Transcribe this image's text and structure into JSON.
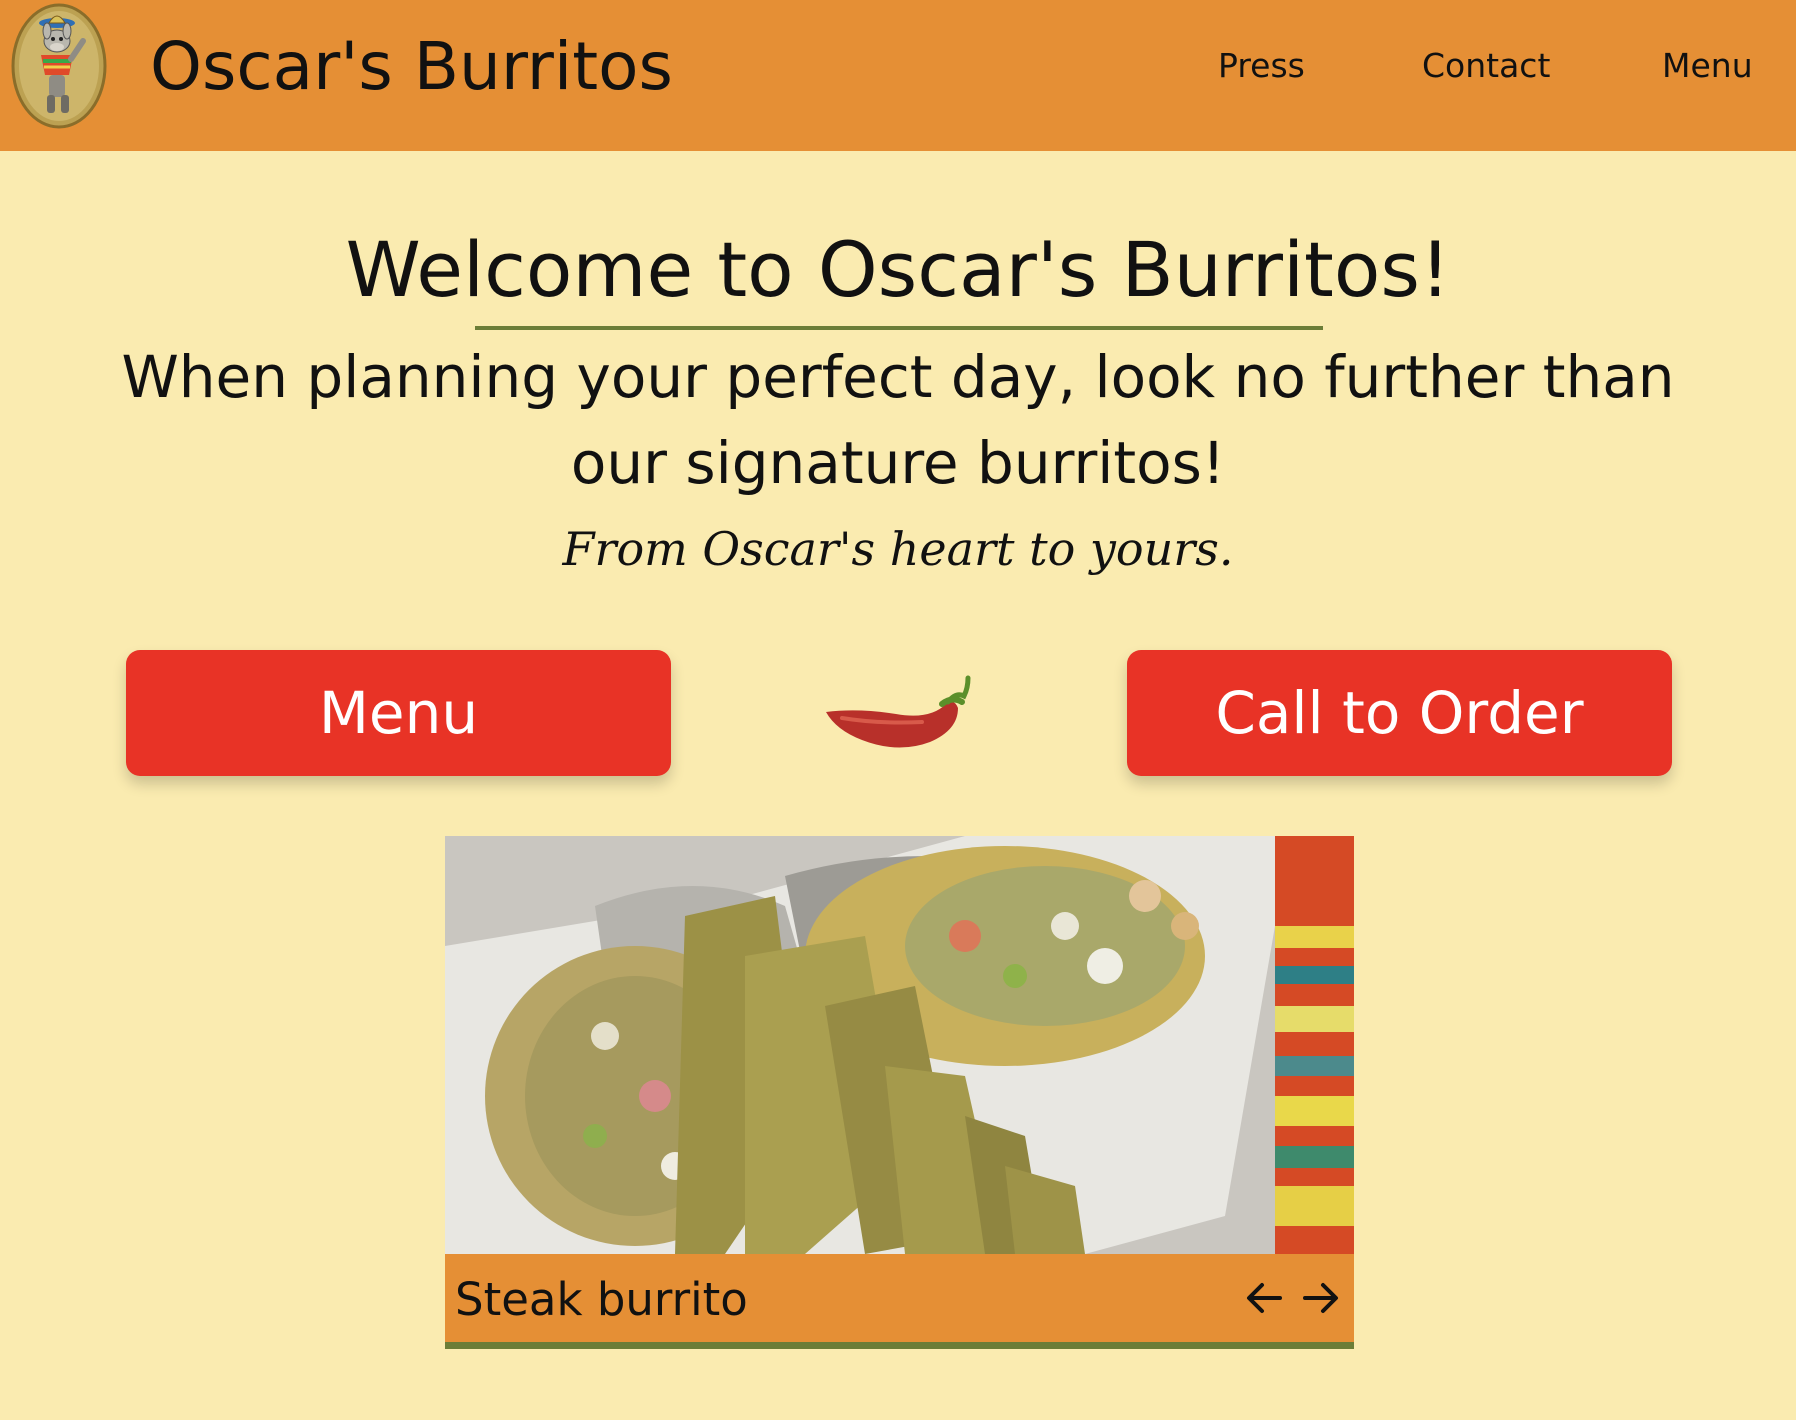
{
  "header": {
    "brand": "Oscar's Burritos",
    "nav": {
      "press": "Press",
      "contact": "Contact",
      "menu": "Menu"
    },
    "logo_icon": "donkey-mascot-logo"
  },
  "hero": {
    "title": "Welcome to Oscar's Burritos!",
    "subtitle": "When planning your perfect day, look no further than our signature burritos!",
    "tagline": "From Oscar's heart to yours."
  },
  "actions": {
    "menu_label": "Menu",
    "call_label": "Call to Order",
    "divider_icon": "chili-pepper-icon"
  },
  "carousel": {
    "caption": "Steak burrito",
    "prev_icon": "arrow-left-icon",
    "next_icon": "arrow-right-icon"
  },
  "colors": {
    "header_bg": "#e58f35",
    "page_bg": "#faebb0",
    "button_bg": "#e83326",
    "accent_green": "#6b7d37"
  }
}
